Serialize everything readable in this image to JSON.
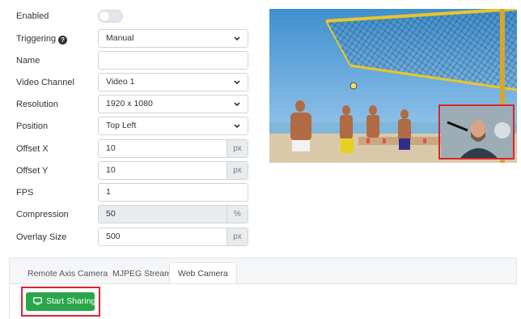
{
  "form": {
    "enabled": {
      "label": "Enabled",
      "value": "off"
    },
    "triggering": {
      "label": "Triggering",
      "value": "Manual"
    },
    "name": {
      "label": "Name",
      "value": ""
    },
    "video_channel": {
      "label": "Video Channel",
      "value": "Video 1"
    },
    "resolution": {
      "label": "Resolution",
      "value": "1920 x 1080"
    },
    "position": {
      "label": "Position",
      "value": "Top Left"
    },
    "offset_x": {
      "label": "Offset X",
      "value": "10",
      "unit": "px"
    },
    "offset_y": {
      "label": "Offset Y",
      "value": "10",
      "unit": "px"
    },
    "fps": {
      "label": "FPS",
      "value": "1"
    },
    "compression": {
      "label": "Compression",
      "value": "50",
      "unit": "%"
    },
    "overlay_size": {
      "label": "Overlay Size",
      "value": "500",
      "unit": "px"
    }
  },
  "tabs": [
    {
      "label": "Remote Axis Camera"
    },
    {
      "label": "MJPEG Stream"
    },
    {
      "label": "Web Camera",
      "active": true
    }
  ],
  "web_camera": {
    "start_button_label": "Start Sharing"
  },
  "icons": {
    "help": "help-circle-icon",
    "caret": "chevron-down-icon",
    "monitor": "monitor-icon"
  },
  "colors": {
    "accent_green": "#2aa54a",
    "highlight_red": "#d9262c"
  }
}
